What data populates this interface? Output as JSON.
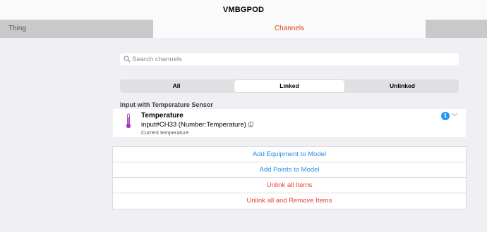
{
  "header": {
    "title": "VMBGPOD"
  },
  "tabs": [
    {
      "label": "Thing"
    },
    {
      "label": "Channels"
    }
  ],
  "search": {
    "placeholder": "Search channels",
    "value": ""
  },
  "filter": {
    "options": [
      "All",
      "Linked",
      "Unlinked"
    ],
    "selected": "Linked"
  },
  "group": {
    "title": "Input with Temperature Sensor"
  },
  "channel": {
    "label": "Temperature",
    "uid": "input#CH33 (Number:Temperature)",
    "description": "Current temperature",
    "link_count": "1",
    "icon": "thermometer-icon"
  },
  "actions": [
    {
      "label": "Add Equipment to Model",
      "color": "#2c8be4"
    },
    {
      "label": "Add Points to Model",
      "color": "#2c8be4"
    },
    {
      "label": "Unlink all Items",
      "color": "#ec3d2e"
    },
    {
      "label": "Unlink all and Remove Items",
      "color": "#ec3d2e"
    }
  ],
  "colors": {
    "accent": "#e1401f",
    "link_blue": "#2c8be4",
    "danger_red": "#ec3d2e",
    "badge_blue": "#2196f3"
  }
}
